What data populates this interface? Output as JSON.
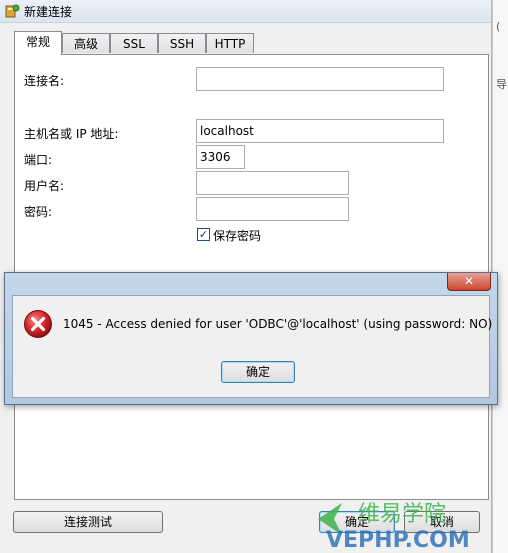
{
  "window": {
    "title": "新建连接"
  },
  "tabs": [
    {
      "label": "常规"
    },
    {
      "label": "高级"
    },
    {
      "label": "SSL"
    },
    {
      "label": "SSH"
    },
    {
      "label": "HTTP"
    }
  ],
  "form": {
    "connection_name_label": "连接名:",
    "connection_name_value": "",
    "host_label": "主机名或 IP 地址:",
    "host_value": "localhost",
    "port_label": "端口:",
    "port_value": "3306",
    "user_label": "用户名:",
    "user_value": "",
    "password_label": "密码:",
    "password_value": "",
    "save_password_label": "保存密码",
    "save_password_checked": true
  },
  "buttons": {
    "test_connection": "连接测试",
    "ok": "确定",
    "cancel": "取消"
  },
  "right_strip": {
    "glyph_top": "(",
    "glyph_bottom": "导"
  },
  "error_dialog": {
    "message": "1045 - Access denied for user 'ODBC'@'localhost' (using password: NO)",
    "ok_label": "确定",
    "close_glyph": "✕"
  },
  "watermark": {
    "text": "维易学院",
    "url_text": "VEPHP.COM"
  },
  "colors": {
    "error_red": "#d4252a",
    "close_red": "#c9482e",
    "watermark_green": "#3fb24a",
    "watermark_blue": "#2a6db5"
  }
}
